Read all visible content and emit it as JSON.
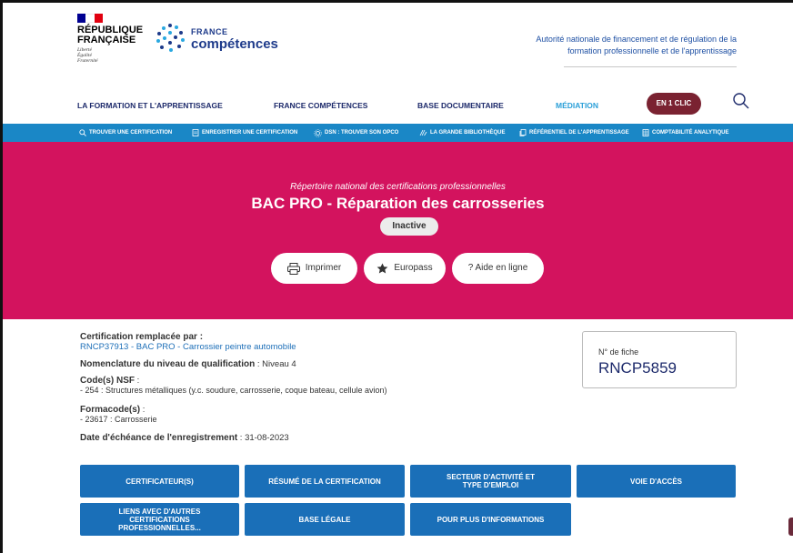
{
  "header": {
    "rf_name_line1": "RÉPUBLIQUE",
    "rf_name_line2": "FRANÇAISE",
    "rf_motto": [
      "Liberté",
      "Égalité",
      "Fraternité"
    ],
    "fc_small": "FRANCE",
    "fc_big": "compétences",
    "authority": "Autorité nationale de financement et de régulation de la formation professionnelle et de l'apprentissage",
    "flag_colors": [
      "#000091",
      "#ffffff",
      "#e1000f"
    ]
  },
  "main_nav": {
    "items": [
      {
        "label": "LA FORMATION ET L'APPRENTISSAGE"
      },
      {
        "label": "FRANCE COMPÉTENCES"
      },
      {
        "label": "BASE DOCUMENTAIRE"
      },
      {
        "label": "MÉDIATION"
      }
    ],
    "cta_label": "EN 1 CLIC",
    "search_icon": "search-icon"
  },
  "toolbar": {
    "items": [
      {
        "label": "TROUVER UNE CERTIFICATION",
        "icon": "search-icon"
      },
      {
        "label": "ENREGISTRER UNE CERTIFICATION",
        "icon": "document-icon"
      },
      {
        "label": "DSN : TROUVER SON OPCO",
        "icon": "gear-icon"
      },
      {
        "label": "LA GRANDE BIBLIOTHÈQUE",
        "icon": "book-icon"
      },
      {
        "label": "RÉFÉRENTIEL DE L'APPRENTISSAGE",
        "icon": "copy-icon"
      },
      {
        "label": "COMPTABILITÉ ANALYTIQUE",
        "icon": "sheet-icon"
      }
    ]
  },
  "hero": {
    "subtitle": "Répertoire national des certifications professionnelles",
    "title": "BAC PRO - Réparation des carrosseries",
    "status": "Inactive",
    "actions": [
      {
        "label": "Imprimer",
        "icon": "printer-icon"
      },
      {
        "label": "Europass",
        "icon": "star-icon"
      },
      {
        "label": "? Aide en ligne",
        "icon": ""
      }
    ],
    "color": "#d3135e"
  },
  "details": {
    "replaced_label": "Certification remplacée par :",
    "replaced_link": "RNCP37913 - BAC PRO - Carrossier peintre automobile",
    "level_label": "Nomenclature du niveau de qualification",
    "level_value": " : Niveau 4",
    "nsf_label": "Code(s) NSF",
    "nsf_colon": " :",
    "nsf_value": "- 254 : Structures métalliques (y.c. soudure, carrosserie, coque bateau, cellule avion)",
    "formacode_label": "Formacode(s)",
    "formacode_colon": " :",
    "formacode_value": "- 23617 : Carrosserie",
    "deadline_label": "Date d'échéance de l'enregistrement",
    "deadline_value": " : 31-08-2023"
  },
  "fiche": {
    "label": "N° de fiche",
    "value": "RNCP5859"
  },
  "sections": [
    {
      "label": "CERTIFICATEUR(S)"
    },
    {
      "label": "RÉSUMÉ DE LA CERTIFICATION"
    },
    {
      "label": "SECTEUR D'ACTIVITÉ ET TYPE D'EMPLOI"
    },
    {
      "label": "VOIE D'ACCÈS"
    },
    {
      "label": "LIENS AVEC D'AUTRES CERTIFICATIONS PROFESSIONNELLES..."
    },
    {
      "label": "BASE LÉGALE"
    },
    {
      "label": "POUR PLUS D'INFORMATIONS"
    }
  ]
}
